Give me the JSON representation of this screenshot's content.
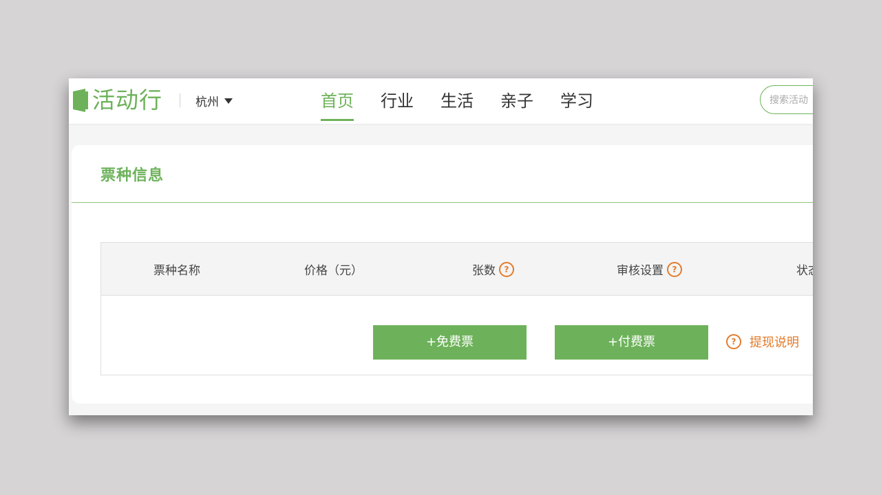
{
  "header": {
    "logo_text": "活动行",
    "city": "杭州",
    "nav": [
      {
        "label": "首页",
        "active": true
      },
      {
        "label": "行业",
        "active": false
      },
      {
        "label": "生活",
        "active": false
      },
      {
        "label": "亲子",
        "active": false
      },
      {
        "label": "学习",
        "active": false
      }
    ],
    "search_placeholder": "搜索活动"
  },
  "tickets": {
    "title": "票种信息",
    "columns": [
      "票种名称",
      "价格（元）",
      "张数",
      "审核设置",
      "状态"
    ],
    "help_icon": "question-circle-icon",
    "free_button": "+免费票",
    "paid_button": "+付费票",
    "withdraw_help": "提现说明"
  },
  "colors": {
    "brand": "#6db25a",
    "help": "#e37b2b"
  }
}
